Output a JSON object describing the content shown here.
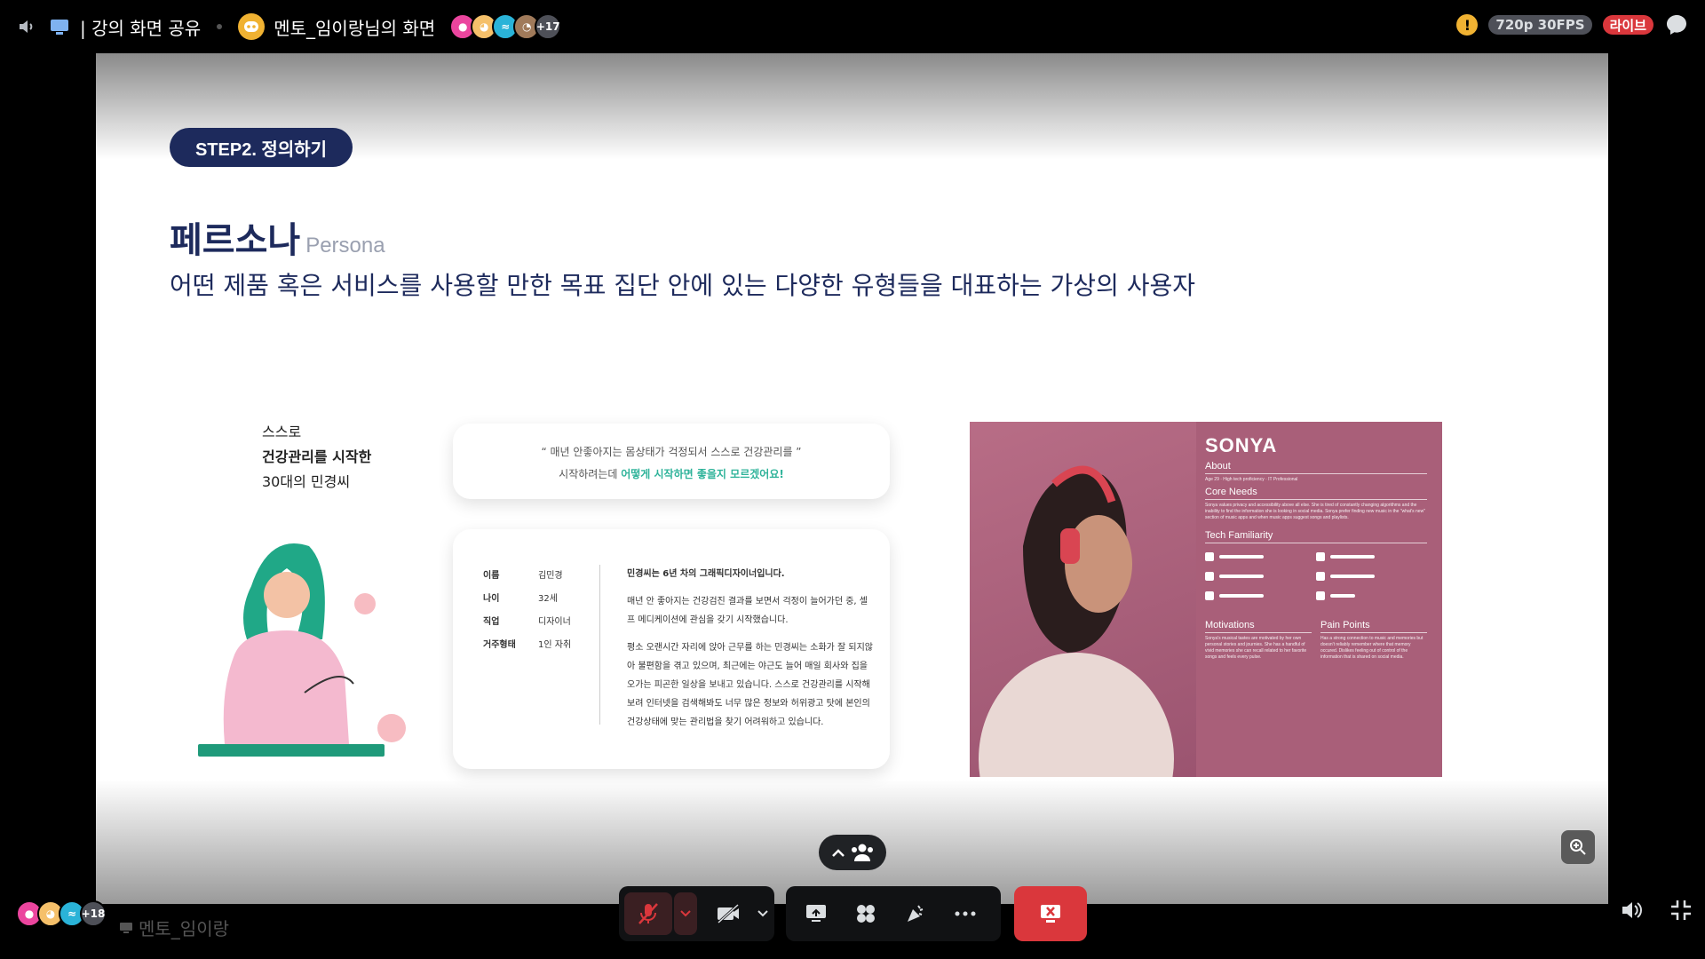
{
  "topbar": {
    "share_title": "| 강의 화면 공유",
    "stream_title": "멘토_임이랑님의 화면",
    "viewer_extra": "+17",
    "quality": "720p 30FPS",
    "live": "라이브"
  },
  "slide": {
    "step": "STEP2. 정의하기",
    "title_ko": "페르소나",
    "title_en": "Persona",
    "subtitle": "어떤 제품 혹은 서비스를 사용할 만한 목표 집단 안에 있는 다양한 유형들을 대표하는 가상의 사용자",
    "intro_1": "스스로",
    "intro_2": "건강관리를 시작한",
    "intro_3": "30대의 민경씨",
    "quote_1": "“ 매년 안좋아지는 몸상태가 걱정되서 스스로 건강관리를 ”",
    "quote_2a": "시작하려는데 ",
    "quote_2b": "어떻게 시작하면 좋을지 모르겠어요!",
    "info": [
      {
        "k": "이름",
        "v": "김민경"
      },
      {
        "k": "나이",
        "v": "32세"
      },
      {
        "k": "직업",
        "v": "디자이너"
      },
      {
        "k": "거주형태",
        "v": "1인 자취"
      }
    ],
    "desc_1": "민경씨는 6년 차의 그래픽디자이너입니다.",
    "desc_2": "매년 안 좋아지는 건강검진 결과를 보면서 걱정이 늘어가던 중, 셀프 메디케이션에 관심을 갖기 시작했습니다.",
    "desc_3": "평소 오랜시간 자리에 앉아 근무를 하는 민경씨는 소화가 잘 되지않아 불편함을 겪고 있으며, 최근에는 야근도 늘어 매일 회사와 집을 오가는 피곤한 일상을 보내고 있습니다. 스스로 건강관리를 시작해보려 인터넷을 검색해봐도 너무 많은 정보와 허위광고 탓에 본인의 건강상태에 맞는 관리법을 찾기 어려워하고 있습니다."
  },
  "sonya": {
    "name": "SONYA",
    "about": "About",
    "about_text": "Age 29 · High tech proficiency · IT Professional",
    "core_needs": "Core Needs",
    "core_text": "Sonya values privacy and accessibility above all else. She is tired of constantly changing algorithms and the inability to find the information she is looking in social media. Sonya prefer finding new music in the \"what's new\" section of music apps and when music apps suggest songs and playlists.",
    "tech": "Tech Familiarity",
    "motivations": "Motivations",
    "motivations_text": "Sonya's musical tastes are motivated by her own personal stories and journies. She has a handful of vivid memories she can recall related to her favorite songs and feels every pulse.",
    "pain_points": "Pain Points",
    "pain_text": "Has a strong connection to music and memories but doesn't reliably remember where that memory occured. Dislikes feeling out of control of the information that is shared on social media."
  },
  "bottom": {
    "viewer_extra": "+18",
    "presenter": "멘토_임이랑"
  },
  "colors": {
    "navy": "#1d2a5c",
    "teal": "#2fb39a",
    "live_red": "#da373c",
    "sonya_bg": "#a95f79"
  }
}
